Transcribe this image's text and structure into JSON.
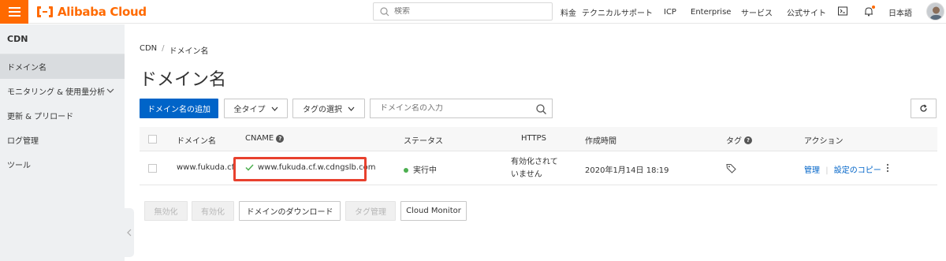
{
  "header": {
    "logo_text": "Alibaba Cloud",
    "search_placeholder": "検索",
    "nav": [
      "料金",
      "テクニカルサポート",
      "ICP",
      "Enterprise",
      "サービス",
      "公式サイト"
    ],
    "language": "日本語",
    "brand_color": "#ff6a00"
  },
  "sidebar": {
    "title": "CDN",
    "items": [
      {
        "label": "ドメイン名",
        "active": true
      },
      {
        "label": "モニタリング & 使用量分析",
        "expandable": true
      },
      {
        "label": "更新 & プリロード"
      },
      {
        "label": "ログ管理"
      },
      {
        "label": "ツール"
      }
    ]
  },
  "breadcrumb": {
    "root": "CDN",
    "separator": "/",
    "current": "ドメイン名"
  },
  "page": {
    "title": "ドメイン名"
  },
  "toolbar": {
    "add_button": "ドメイン名の追加",
    "type_filter": "全タイプ",
    "tag_select": "タグの選択",
    "search_placeholder": "ドメイン名の入力"
  },
  "table": {
    "columns": [
      "ドメイン名",
      "CNAME",
      "ステータス",
      "HTTPS",
      "作成時間",
      "タグ",
      "アクション"
    ],
    "rows": [
      {
        "domain": "www.fukuda.cf",
        "cname": "www.fukuda.cf.w.cdngslb.com",
        "status": "実行中",
        "https_line1": "有効化されて",
        "https_line2": "いません",
        "created": "2020年1月14日 18:19",
        "action_manage": "管理",
        "action_copy": "設定のコピー"
      }
    ]
  },
  "bulk_actions": {
    "disable": "無効化",
    "enable": "有効化",
    "download": "ドメインのダウンロード",
    "tag_manage": "タグ管理",
    "cloud_monitor": "Cloud Monitor"
  },
  "colors": {
    "primary": "#0064c8",
    "highlight": "#e8412e",
    "status_running": "#4caf50"
  }
}
